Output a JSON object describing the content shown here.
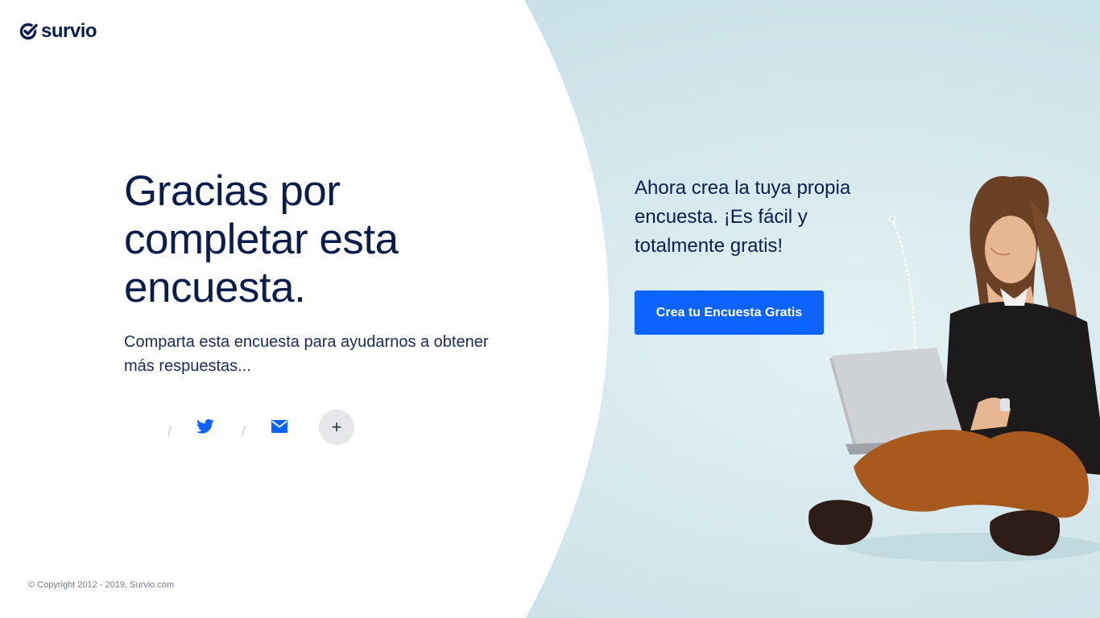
{
  "brand": {
    "name": "survio"
  },
  "main": {
    "headline": "Gracias por completar esta encuesta.",
    "subtext": "Comparta esta encuesta para ayudarnos a obtener más respuestas...",
    "share": {
      "separator": "/",
      "items": [
        {
          "icon": "facebook-icon"
        },
        {
          "icon": "twitter-icon"
        },
        {
          "icon": "email-icon"
        }
      ],
      "more_label": "+"
    }
  },
  "promo": {
    "text": "Ahora crea la tuya propia encuesta. ¡Es fácil y totalmente gratis!",
    "button_label": "Crea tu Encuesta Gratis"
  },
  "footer": {
    "copyright": "© Copyright 2012 - 2019, Survio.com"
  },
  "colors": {
    "brand_navy": "#0b1d4d",
    "accent_blue": "#0d63ff",
    "panel_bg": "#cde3e9",
    "left_bg": "#ffffff"
  }
}
